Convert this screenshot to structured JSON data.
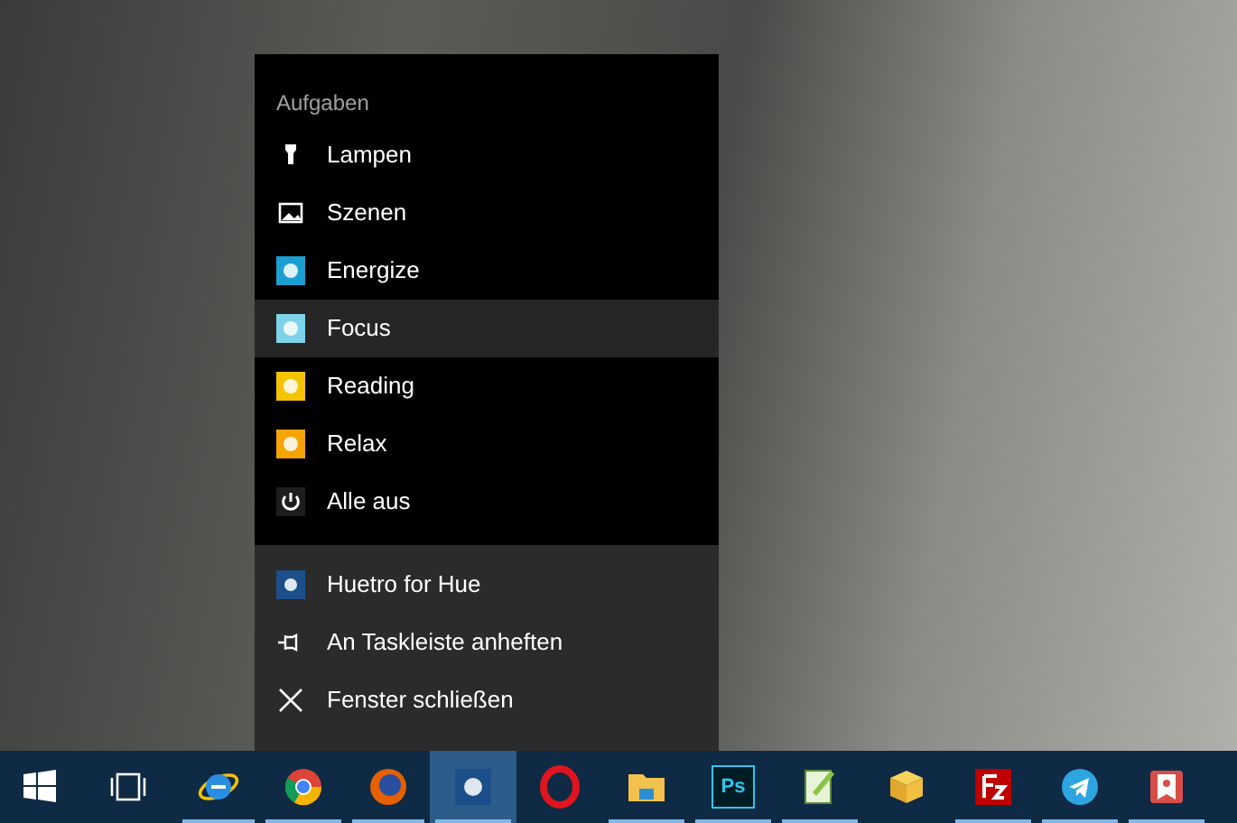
{
  "jump_list": {
    "header": "Aufgaben",
    "tasks": [
      {
        "label": "Lampen",
        "kind": "lamp",
        "hovered": false
      },
      {
        "label": "Szenen",
        "kind": "picture",
        "hovered": false
      },
      {
        "label": "Energize",
        "kind": "tile",
        "color": "#1a9fd0",
        "hovered": false
      },
      {
        "label": "Focus",
        "kind": "tile",
        "color": "#7fd3e8",
        "hovered": true
      },
      {
        "label": "Reading",
        "kind": "tile",
        "color": "#f5c400",
        "hovered": false
      },
      {
        "label": "Relax",
        "kind": "tile",
        "color": "#f5a300",
        "hovered": false
      },
      {
        "label": "Alle aus",
        "kind": "power",
        "hovered": false
      }
    ],
    "actions": [
      {
        "label": "Huetro for Hue",
        "kind": "app"
      },
      {
        "label": "An Taskleiste anheften",
        "kind": "pin"
      },
      {
        "label": "Fenster schließen",
        "kind": "close"
      }
    ]
  },
  "taskbar": [
    {
      "kind": "start",
      "running": false,
      "active": false
    },
    {
      "kind": "taskview",
      "running": false,
      "active": false
    },
    {
      "kind": "ie",
      "running": true,
      "active": false
    },
    {
      "kind": "chrome",
      "running": true,
      "active": false
    },
    {
      "kind": "firefox",
      "running": true,
      "active": false
    },
    {
      "kind": "app",
      "running": true,
      "active": true
    },
    {
      "kind": "opera",
      "running": false,
      "active": false
    },
    {
      "kind": "explorer",
      "running": true,
      "active": false
    },
    {
      "kind": "photoshop",
      "label": "Ps",
      "running": true,
      "active": false
    },
    {
      "kind": "notepad",
      "running": true,
      "active": false
    },
    {
      "kind": "box",
      "running": false,
      "active": false
    },
    {
      "kind": "filezilla",
      "running": true,
      "active": false
    },
    {
      "kind": "telegram",
      "running": true,
      "active": false
    },
    {
      "kind": "wunderlist",
      "running": true,
      "active": false
    }
  ]
}
